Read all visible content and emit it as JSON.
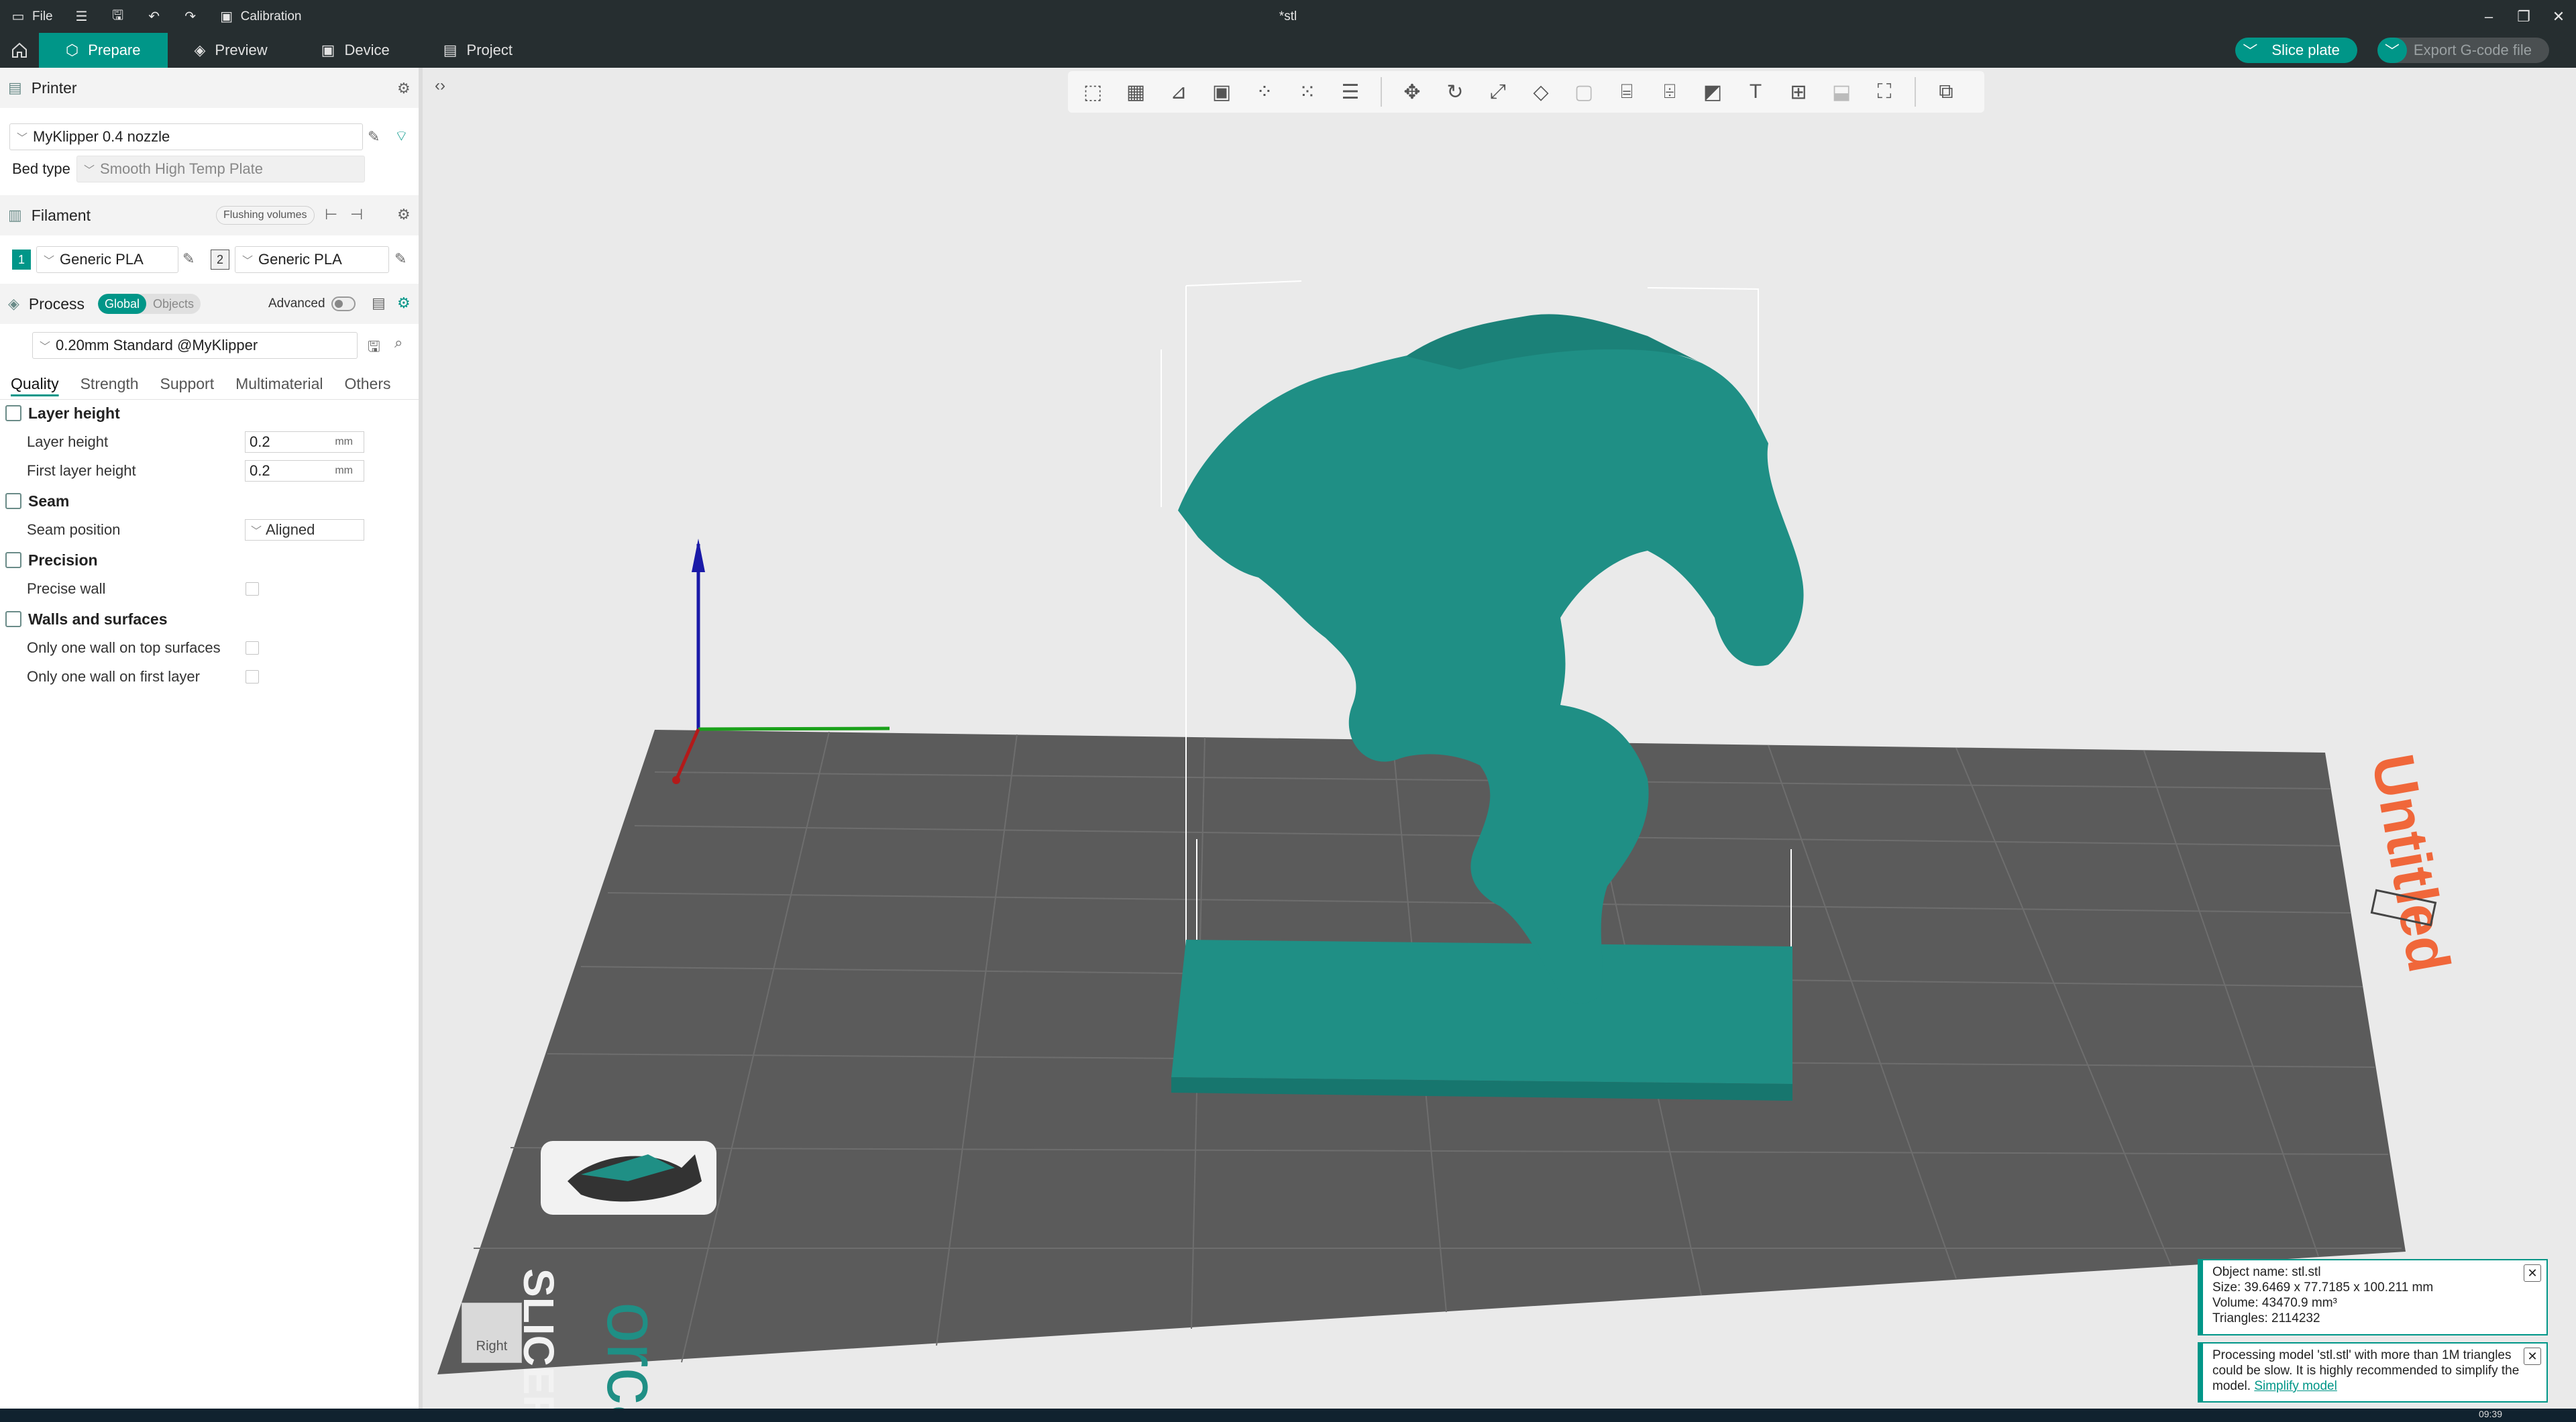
{
  "titlebar": {
    "file_label": "File",
    "calibration_label": "Calibration",
    "document_title": "*stl"
  },
  "nav": {
    "tabs": [
      {
        "label": "Prepare",
        "icon": "cube-icon"
      },
      {
        "label": "Preview",
        "icon": "layers-icon"
      },
      {
        "label": "Device",
        "icon": "device-icon"
      },
      {
        "label": "Project",
        "icon": "project-icon"
      }
    ],
    "slice_label": "Slice plate",
    "export_label": "Export G-code file"
  },
  "printer": {
    "section_title": "Printer",
    "name": "MyKlipper 0.4 nozzle",
    "bed_type_label": "Bed type",
    "bed_type": "Smooth High Temp Plate"
  },
  "filament": {
    "section_title": "Filament",
    "flushing_label": "Flushing volumes",
    "slots": [
      {
        "num": "1",
        "name": "Generic PLA",
        "color": "#009688"
      },
      {
        "num": "2",
        "name": "Generic PLA",
        "color": "#f0f0f0"
      }
    ]
  },
  "process": {
    "section_title": "Process",
    "global_label": "Global",
    "objects_label": "Objects",
    "advanced_label": "Advanced",
    "preset": "0.20mm Standard @MyKlipper"
  },
  "tabs": [
    "Quality",
    "Strength",
    "Support",
    "Multimaterial",
    "Others"
  ],
  "quality": {
    "layer_height_group": "Layer height",
    "layer_height_label": "Layer height",
    "layer_height": "0.2",
    "first_layer_label": "First layer height",
    "first_layer": "0.2",
    "unit": "mm",
    "seam_group": "Seam",
    "seam_position_label": "Seam position",
    "seam_position": "Aligned",
    "precision_group": "Precision",
    "precise_wall_label": "Precise wall",
    "walls_group": "Walls and surfaces",
    "one_wall_top_label": "Only one wall on top surfaces",
    "one_wall_first_label": "Only one wall on first layer"
  },
  "viewport": {
    "plate_label": "Untitled",
    "logo_text": "orca",
    "logo_sub": "SLICER",
    "view_cube_label": "Right",
    "model_color": "#1f8f85",
    "plate_color": "#5b5b5b",
    "accent_color": "#009688"
  },
  "notifications": {
    "object_name": "Object name: stl.stl",
    "size": "Size: 39.6469 x 77.7185 x 100.211 mm",
    "volume": "Volume: 43470.9 mm³",
    "triangles": "Triangles: 2114232",
    "warning_text": "Processing model 'stl.stl' with more than 1M triangles could be slow. It is highly recommended to simplify the model.",
    "warning_link": "Simplify model"
  },
  "clock": "09:39"
}
